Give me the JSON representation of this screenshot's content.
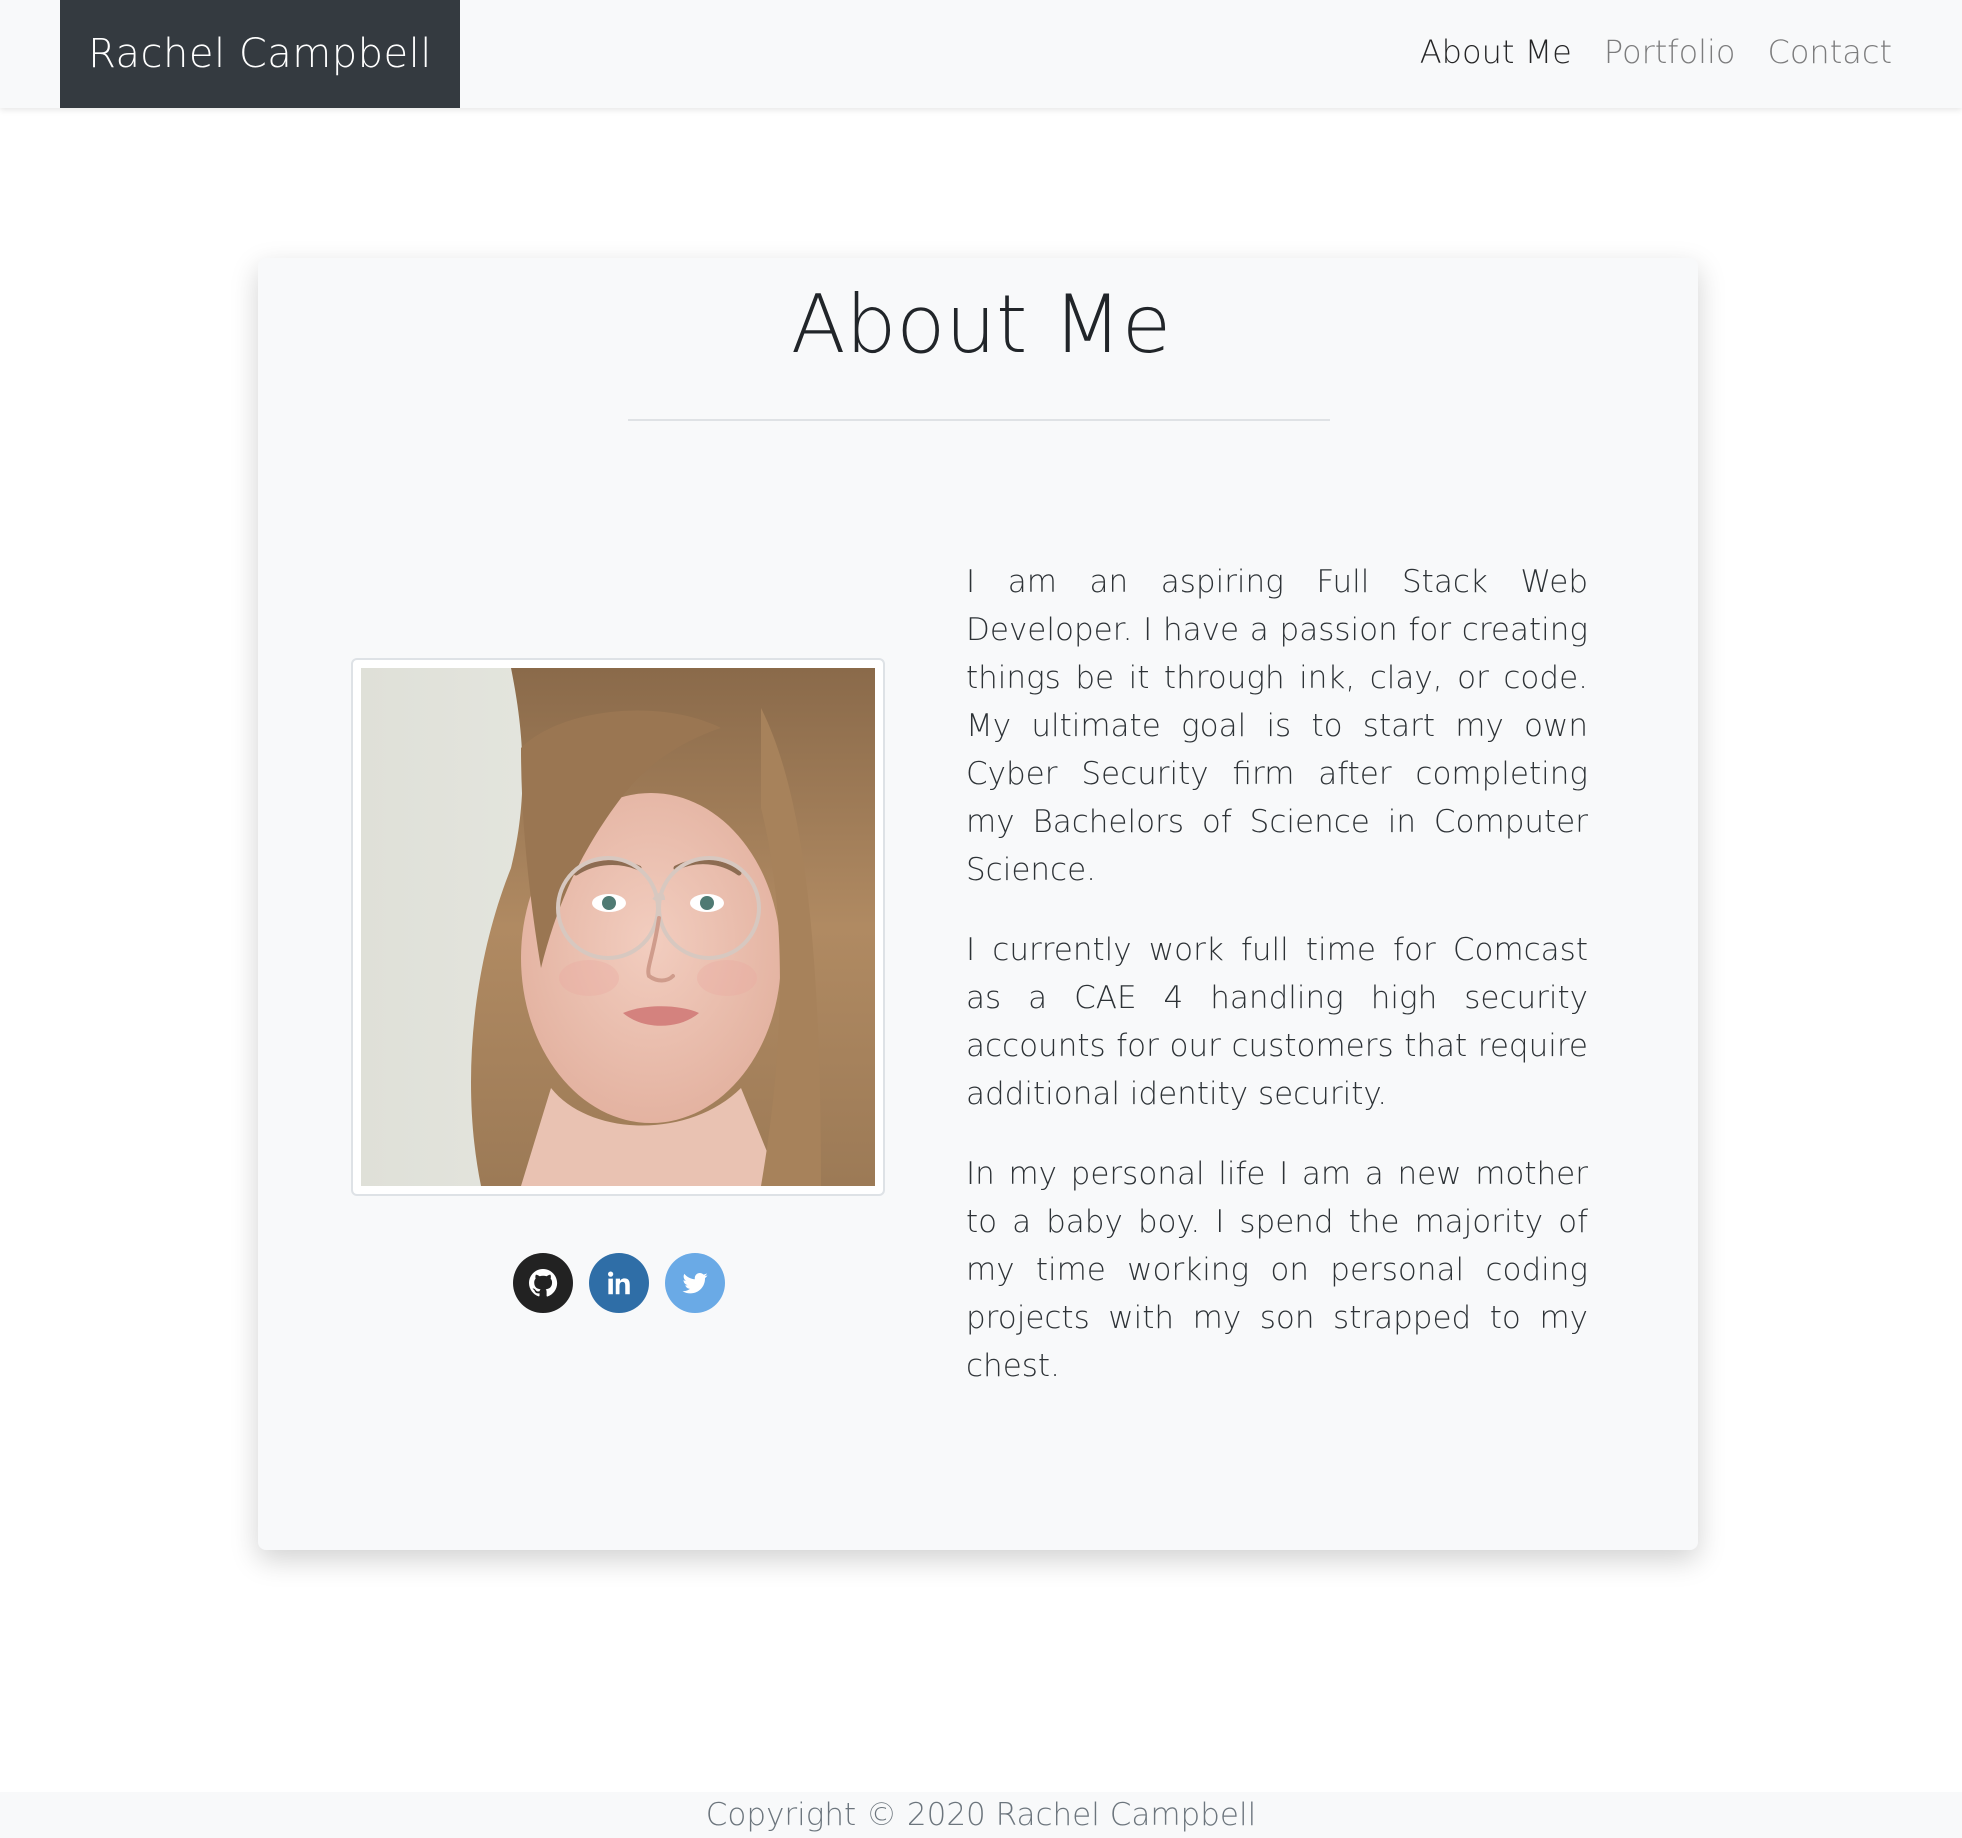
{
  "navbar": {
    "brand": "Rachel Campbell",
    "links": [
      {
        "label": "About Me",
        "active": true
      },
      {
        "label": "Portfolio",
        "active": false
      },
      {
        "label": "Contact",
        "active": false
      }
    ]
  },
  "about": {
    "title": "About Me",
    "paragraphs": [
      "I am an aspiring Full Stack Web Developer. I have a passion for creating things be it through ink, clay, or code. My ultimate goal is to start my own Cyber Security firm after completing my Bachelors of Science in Computer Science.",
      "I currently work full time for Comcast as a CAE 4 handling high security accounts for our customers that require additional identity security.",
      "In my personal life I am a new mother to a baby boy. I spend the majority of my time working on personal coding projects with my son strapped to my chest."
    ],
    "socials": [
      {
        "icon": "github-icon",
        "color": "#222222"
      },
      {
        "icon": "linkedin-icon",
        "color": "#2f6ea7"
      },
      {
        "icon": "twitter-icon",
        "color": "#6aaae6"
      }
    ]
  },
  "footer": {
    "copyright": "Copyright © 2020 Rachel Campbell"
  }
}
